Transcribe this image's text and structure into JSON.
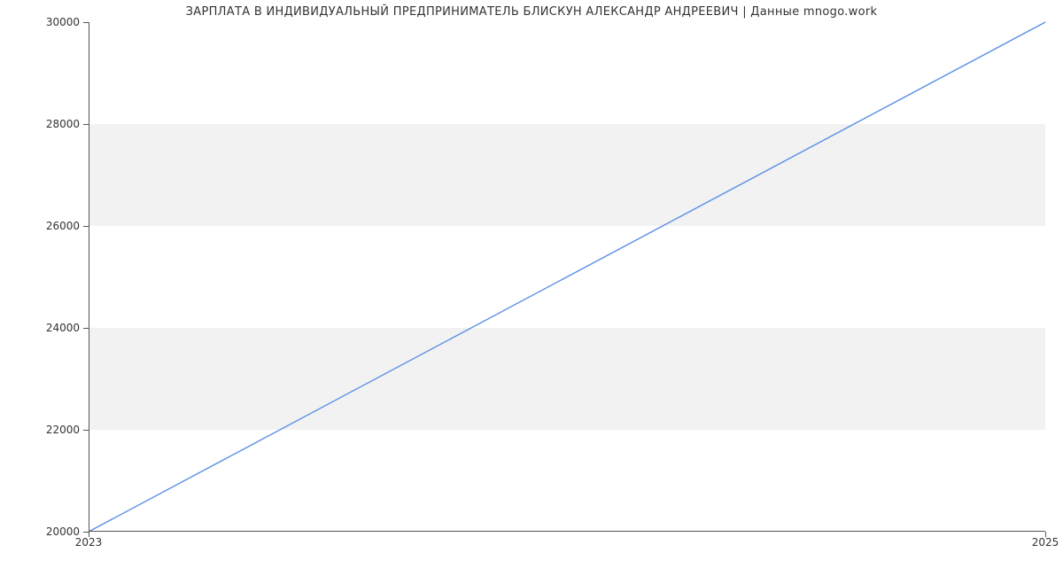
{
  "chart_data": {
    "type": "line",
    "title": "ЗАРПЛАТА В ИНДИВИДУАЛЬНЫЙ ПРЕДПРИНИМАТЕЛЬ БЛИСКУН АЛЕКСАНДР АНДРЕЕВИЧ | Данные mnogo.work",
    "xlabel": "",
    "ylabel": "",
    "x_ticks": [
      "2023",
      "2025"
    ],
    "y_ticks": [
      20000,
      22000,
      24000,
      26000,
      28000,
      30000
    ],
    "ylim": [
      20000,
      30000
    ],
    "xlim": [
      2023,
      2025
    ],
    "series": [
      {
        "name": "salary",
        "color": "#5a8fe6",
        "x": [
          2023,
          2025
        ],
        "y": [
          20000,
          30000
        ]
      }
    ],
    "grid_bands": true
  },
  "labels": {
    "y0": "20000",
    "y1": "22000",
    "y2": "24000",
    "y3": "26000",
    "y4": "28000",
    "y5": "30000",
    "x0": "2023",
    "x1": "2025"
  }
}
